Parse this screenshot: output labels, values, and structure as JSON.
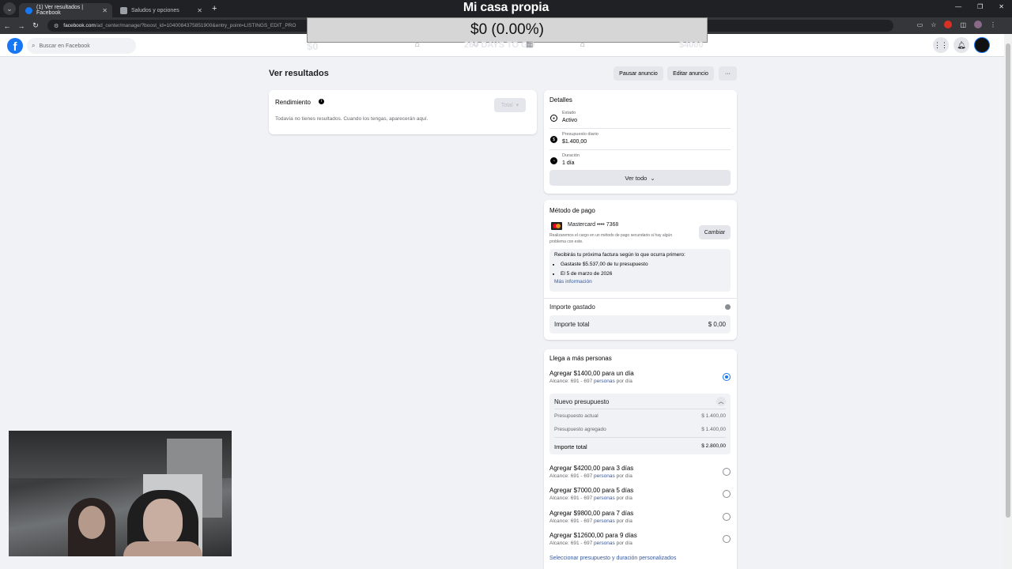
{
  "browser": {
    "tabs": [
      {
        "label": "(1) Ver resultados | Facebook"
      },
      {
        "label": "Saludos y opciones"
      }
    ],
    "url_domain": "facebook.com",
    "url_path": "/ad_center/manage/?boost_id=1040084375851900&entry_point=LISTINGS_EDIT_PRO"
  },
  "overlay": {
    "title": "Mi casa propia",
    "progress_text": "$0 (0.00%)",
    "progress_fraction": 0.0,
    "marker_left": "$0",
    "marker_center": "260 DAYS TO GO",
    "marker_right": "$4000"
  },
  "fb": {
    "search_placeholder": "Buscar en Facebook"
  },
  "page": {
    "title": "Ver resultados",
    "pause_label": "Pausar anuncio",
    "edit_label": "Editar anuncio",
    "more_label": "···"
  },
  "rendimiento": {
    "title": "Rendimiento",
    "select_label": "Total",
    "empty_text": "Todavía no tienes resultados. Cuando los tengas, aparecerán aquí."
  },
  "detalles": {
    "title": "Detalles",
    "rows": [
      {
        "label": "Estado",
        "value": "Activo"
      },
      {
        "label": "Presupuesto diario",
        "value": "$1.400,00"
      },
      {
        "label": "Duración",
        "value": "1 día"
      }
    ],
    "see_all_label": "Ver todo"
  },
  "pago": {
    "title": "Método de pago",
    "card_label": "Mastercard •••• 7368",
    "card_note": "Realizaremos el cargo en un método de pago secundario si hay algún problema con este.",
    "change_label": "Cambiar",
    "invoice_heading": "Recibirás tu próxima factura según lo que ocurra primero:",
    "invoice_items": [
      "Gastaste $5.537,00 de tu presupuesto",
      "El 5 de marzo de 2026"
    ],
    "more_info_label": "Más información",
    "spent_title": "Importe gastado",
    "total_label": "Importe total",
    "total_value": "$ 0,00"
  },
  "llega": {
    "title": "Llega a más personas",
    "options": [
      {
        "title": "Agregar $1400,00 para un día",
        "reach": "Alcance: 691 - 697",
        "people": "personas",
        "suffix": "por día",
        "selected": true
      },
      {
        "title": "Agregar $4200,00 para 3 días",
        "reach": "Alcance: 691 - 697",
        "people": "personas",
        "suffix": "por día",
        "selected": false
      },
      {
        "title": "Agregar $7000,00 para 5 días",
        "reach": "Alcance: 691 - 697",
        "people": "personas",
        "suffix": "por día",
        "selected": false
      },
      {
        "title": "Agregar $9800,00 para 7 días",
        "reach": "Alcance: 691 - 697",
        "people": "personas",
        "suffix": "por día",
        "selected": false
      },
      {
        "title": "Agregar $12600,00 para 9 días",
        "reach": "Alcance: 691 - 697",
        "people": "personas",
        "suffix": "por día",
        "selected": false
      }
    ],
    "nuevo": {
      "title": "Nuevo presupuesto",
      "rows": [
        {
          "label": "Presupuesto actual",
          "value": "$ 1.400,00"
        },
        {
          "label": "Presupuesto agregado",
          "value": "$ 1.400,00"
        }
      ],
      "total_label": "Importe total",
      "total_value": "$ 2.800,00"
    },
    "custom_link": "Seleccionar presupuesto y duración personalizados"
  },
  "colors": {
    "fb_blue": "#1877f2",
    "link": "#385898",
    "chrome_dark": "#202124"
  }
}
